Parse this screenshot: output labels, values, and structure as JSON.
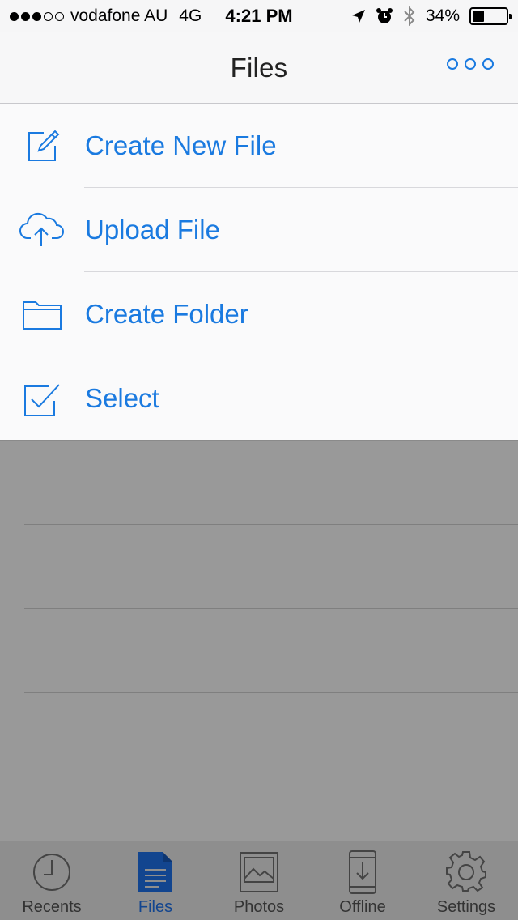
{
  "status_bar": {
    "carrier": "vodafone AU",
    "network": "4G",
    "time": "4:21 PM",
    "battery": "34%",
    "signal_filled": 3,
    "signal_total": 5
  },
  "nav": {
    "title": "Files"
  },
  "menu": {
    "items": [
      {
        "label": "Create New File",
        "icon": "edit-icon"
      },
      {
        "label": "Upload File",
        "icon": "cloud-upload-icon"
      },
      {
        "label": "Create Folder",
        "icon": "folder-icon"
      },
      {
        "label": "Select",
        "icon": "checkbox-icon"
      }
    ]
  },
  "tabs": [
    {
      "label": "Recents",
      "icon": "clock-icon",
      "active": false
    },
    {
      "label": "Files",
      "icon": "document-icon",
      "active": true
    },
    {
      "label": "Photos",
      "icon": "image-icon",
      "active": false
    },
    {
      "label": "Offline",
      "icon": "phone-download-icon",
      "active": false
    },
    {
      "label": "Settings",
      "icon": "gear-icon",
      "active": false
    }
  ],
  "colors": {
    "accent": "#1a7ae0",
    "active_tab": "#12458f"
  }
}
